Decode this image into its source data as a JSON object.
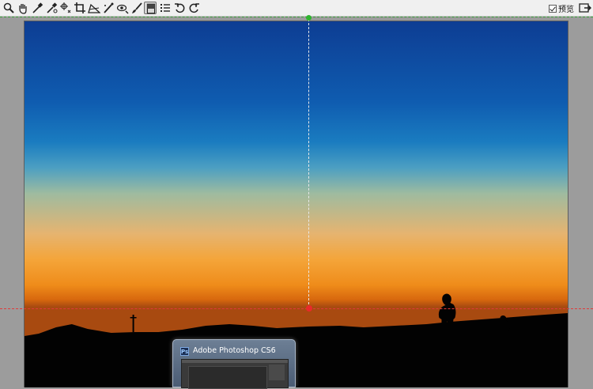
{
  "toolbar": {
    "tools": [
      {
        "name": "zoom-tool-icon",
        "active": false
      },
      {
        "name": "hand-tool-icon",
        "active": false
      },
      {
        "name": "white-balance-tool-icon",
        "active": false
      },
      {
        "name": "color-sampler-tool-icon",
        "active": false
      },
      {
        "name": "targeted-adjustment-tool-icon",
        "active": false
      },
      {
        "name": "crop-tool-icon",
        "active": false
      },
      {
        "name": "straighten-tool-icon",
        "active": false
      },
      {
        "name": "spot-removal-tool-icon",
        "active": false
      },
      {
        "name": "red-eye-removal-tool-icon",
        "active": false
      },
      {
        "name": "adjustment-brush-icon",
        "active": false
      },
      {
        "name": "graduated-filter-icon",
        "active": true
      },
      {
        "name": "preferences-list-icon",
        "active": false
      },
      {
        "name": "rotate-left-icon",
        "active": false
      },
      {
        "name": "rotate-right-icon",
        "active": false
      }
    ],
    "preview_label": "预览",
    "preview_checked": true
  },
  "taskbar_popup": {
    "title": "Adobe Photoshop CS6",
    "icon_text": "Ps"
  },
  "colors": {
    "guide_start": "#2fb52f",
    "guide_end": "#e82a2a",
    "sky_top": "#0d3d93",
    "horizon": "#ef8c1a"
  }
}
